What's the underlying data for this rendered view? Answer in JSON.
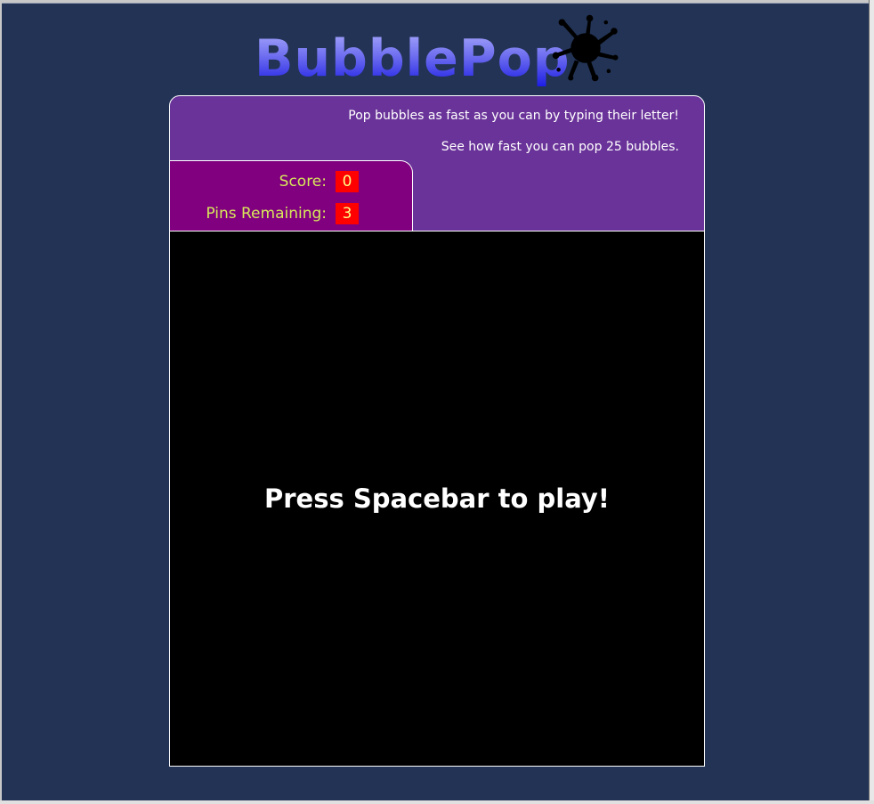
{
  "app": {
    "logo_text": "BubblePop",
    "logo_icon": "ink-splat-icon"
  },
  "instructions": {
    "line1": "Pop bubbles as fast as you can by typing their letter!",
    "line2": "See how fast you can pop 25 bubbles."
  },
  "stats": {
    "score_label": "Score:",
    "score_value": "0",
    "pins_label": "Pins Remaining:",
    "pins_value": "3"
  },
  "game": {
    "prompt": "Press Spacebar to play!"
  },
  "colors": {
    "page_background": "#223355",
    "panel_background": "#6a3399",
    "stats_background": "#800080",
    "stat_label": "#d7e85a",
    "stat_value_background": "#ff0000",
    "game_background": "#000000"
  }
}
